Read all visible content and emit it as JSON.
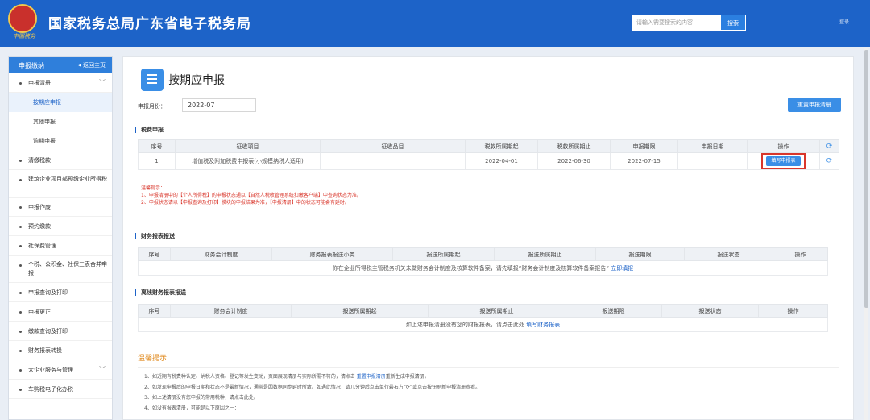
{
  "header": {
    "emblem_text": "中国税务",
    "title": "国家税务总局广东省电子税务局",
    "search_placeholder": "请输入需要搜索的内容",
    "search_button": "搜索",
    "user_text": "登录"
  },
  "sidebar": {
    "head_label": "申报缴纳",
    "back_label": "◂ 返回主页",
    "items": [
      {
        "label": "申报清册",
        "chevron": "﹀"
      },
      {
        "label": "清缴税款"
      },
      {
        "label": "建筑企业项目部预缴企业所得税"
      },
      {
        "label": "申报作废"
      },
      {
        "label": "预约缴款"
      },
      {
        "label": "社保费管理"
      },
      {
        "label": "个税、公积金、社保三表合并申报",
        "chevron": "﹀"
      },
      {
        "label": "申报查询及打印"
      },
      {
        "label": "申报更正"
      },
      {
        "label": "缴款查询及打印"
      },
      {
        "label": "财务报表转换"
      },
      {
        "label": "大企业服务与管理",
        "chevron": "﹀"
      },
      {
        "label": "车购税电子化办税"
      }
    ],
    "subitems": [
      "按期应申报",
      "其他申报",
      "逾期申报"
    ]
  },
  "main": {
    "title": "按期应申报",
    "month_label": "申报月份：",
    "month_value": "2022-07",
    "refresh_list_button": "重置申报清册"
  },
  "tax_section": {
    "title": "税费申报",
    "headers": [
      "序号",
      "征收项目",
      "征收品目",
      "税款所属期起",
      "税款所属期止",
      "申报期限",
      "申报日期",
      "操作"
    ],
    "row": {
      "index": "1",
      "item": "增值税及附加税费申报表(小规模纳税人适用)",
      "sub_item": "",
      "period_start": "2022-04-01",
      "period_end": "2022-06-30",
      "deadline": "2022-07-15",
      "date": "",
      "action": "填写申报表"
    }
  },
  "warning": {
    "title": "温馨提示：",
    "lines": [
      "1、申报清册中的【个人所得税】的申报状态通以【自然人税收管理系统扣缴客户端】中查询状态为准。",
      "2、申报状态请以【申报查询及打印】模块的申报结果为准，【申报清册】中的状态可能会有延时。"
    ]
  },
  "fin_section": {
    "title": "财务报表报送",
    "headers": [
      "序号",
      "财务会计制度",
      "财务报表报送小类",
      "报送所属期起",
      "报送所属期止",
      "报送期限",
      "报送状态",
      "操作"
    ],
    "notice": "你在企业所得税主管税务机关未做财务会计制度及核算软件备案，请先填报“财务会计制度及核算软件备案报告”",
    "notice_link": "立即填报"
  },
  "offline_section": {
    "title": "离线财务报表报送",
    "headers": [
      "序号",
      "财务会计制度",
      "报送所属期起",
      "报送所属期止",
      "报送期限",
      "报送状态",
      "操作"
    ],
    "notice": "如上述申报清册没有您的财报报表，请点击此处",
    "notice_link": "填写财务报表"
  },
  "tips": {
    "title": "温馨提示",
    "lines": [
      "1、如近期有税费种认定、纳税人资格、登记等发生变动，页面展现清册与实际所需不符的，请点击",
      "2、如发现申报后的申报日期和状态不是最新情况，通常是因数据同步延时所致。如遇此情况，请几分钟后点击单行最右方“⟳”或点击按钮刷新申报清册查看。",
      "3、如上述清册没有您申报的常用税种，请点击此处。",
      "4、如没有报表清册，可能是以下原因之一："
    ],
    "tip1_link": "重置申报清册",
    "tip1_tail": "重新生成申报清册。"
  }
}
